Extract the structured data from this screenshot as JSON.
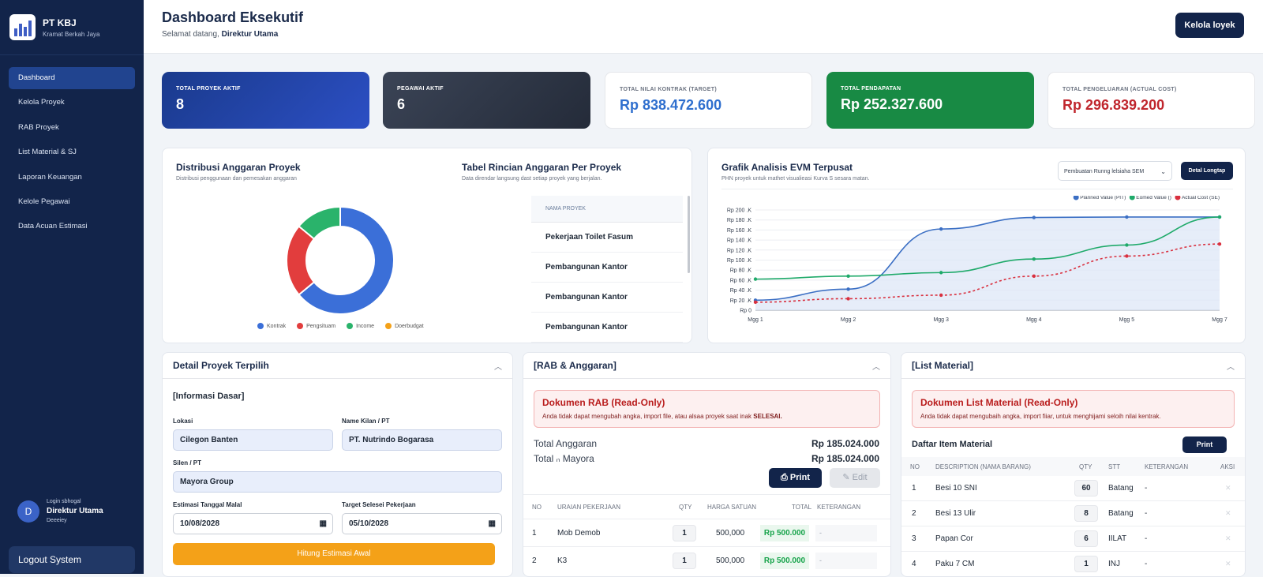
{
  "brand": {
    "name": "PT KBJ",
    "tagline": "Kramat Berkah Jaya"
  },
  "nav": [
    "Dashboard",
    "Kelola Proyek",
    "RAB Proyek",
    "List Material & SJ",
    "Laporan Keuangan",
    "Kelole Pegawai",
    "Data Acuan Estimasi"
  ],
  "user": {
    "initial": "D",
    "login_label": "Login sbhogal",
    "name": "Direktur Utama",
    "role": "Deeeiey"
  },
  "logout": "Logout System",
  "header": {
    "title": "Dashboard Eksekutif",
    "welcome": "Selamat datang,",
    "welcome_name": "Direktur Utama",
    "button": "Kelola loyek"
  },
  "kpis": [
    {
      "label": "TOTAL PROYEK AKTIF",
      "value": "8"
    },
    {
      "label": "PEGAWAI AKTIF",
      "value": "6"
    },
    {
      "label": "TOTAL NILAI KONTRAK (TARGET)",
      "value": "Rp 838.472.600"
    },
    {
      "label": "TOTAL PENDAPATAN",
      "value": "Rp 252.327.600"
    },
    {
      "label": "TOTAL PENGELUARAN (ACTUAL COST)",
      "value": "Rp 296.839.200"
    }
  ],
  "colors": {
    "navy": "#12244a",
    "blue": "#3b6fd8",
    "red": "#e23d3d",
    "green": "#2ab36b",
    "orange": "#f4a118"
  },
  "distribusi": {
    "title": "Distribusi Anggaran Proyek",
    "subtitle": "Distribusi penggunaan dan pemesakan anggaran",
    "chart_data": {
      "type": "pie",
      "labels": [
        "Kontrak",
        "Pengsituam",
        "Income",
        "Doerbudgat"
      ],
      "values": [
        64,
        22,
        14,
        0
      ],
      "colors": [
        "#3b6fd8",
        "#e23d3d",
        "#2ab36b",
        "#f4a118"
      ],
      "legend": "bottom"
    }
  },
  "tabel": {
    "title": "Tabel Rincian Anggaran Per Proyek",
    "subtitle": "Data direndar langsung dast setiap proyek yang berjalan.",
    "header": "NAMA PROYEK",
    "rows": [
      "Pekerjaan Toilet Fasum",
      "Pembangunan Kantor",
      "Pembangunan Kantor",
      "Pembangunan Kantor"
    ]
  },
  "evm": {
    "title": "Grafik Analisis EVM Terpusat",
    "subtitle": "PHN proyek untuk mathet visualieasi Kurva S sesara matan.",
    "select": "Pembuatan Runng lelsiaha SEM",
    "button": "Detal Longtap",
    "chart_data": {
      "type": "line",
      "x": [
        "Mgg 1",
        "Mgg 2",
        "Mgg 3",
        "Mgg 4",
        "Mgg 5",
        "Mgg 7"
      ],
      "yticks": [
        "Rp 0",
        "Rp 20 .K",
        "Rp 40 .K",
        "Rp 60 .K",
        "Rp 80 .K",
        "Rp 100 .K",
        "Rp 120 .K",
        "Rp 140 .K",
        "Rp 160 .K",
        "Rp 180 .K",
        "Rp 200 .K"
      ],
      "ylim": [
        0,
        200
      ],
      "series": [
        {
          "name": "Planned Value (PIT)",
          "color": "#3b6fc4",
          "values": [
            20,
            42,
            162,
            185,
            186,
            186
          ]
        },
        {
          "name": "Eomed Value ()",
          "color": "#1faa6a",
          "values": [
            62,
            68,
            75,
            102,
            130,
            186
          ]
        },
        {
          "name": "Actual Cost (SE)",
          "color": "#d9303f",
          "values": [
            16,
            23,
            30,
            68,
            108,
            132
          ]
        }
      ],
      "legend": "top-right"
    }
  },
  "detail": {
    "title": "Detail Proyek Terpilih",
    "section": "[Informasi Dasar]",
    "lokasi_label": "Lokasi",
    "lokasi": "Cilegon Banten",
    "klien_label": "Name Kilan / PT",
    "klien": "PT. Nutrindo Bogarasa",
    "silen_label": "Silen / PT",
    "silen": "Mayora Group",
    "mulai_label": "Estimasi Tanggal Malal",
    "mulai": "10/08/2028",
    "target_label": "Target Selesei Pekerjaan",
    "target": "05/10/2028",
    "button": "Hitung Estimasi Awal"
  },
  "rab": {
    "title": "[RAB & Anggaran]",
    "alert_title": "Dokumen RAB (Read-Only)",
    "alert_body": "Anda tidak dapat mengubah angka, import file, atau alsaa proyek saat inak",
    "alert_bold": "SELESAI.",
    "total_label": "Total Anggaran",
    "total_value": "Rp 185.024.000",
    "mayora_label": "Total ₙ Mayora",
    "mayora_value": "Rp 185.024.000",
    "print": "Print",
    "edit": "Edit",
    "headers": [
      "NO",
      "URAIAN PEKERJAAN",
      "QTY",
      "HARGA SATUAN",
      "TOTAL",
      "KETERANGAN"
    ],
    "rows": [
      {
        "no": "1",
        "uraian": "Mob Demob",
        "qty": "1",
        "harga": "500,000",
        "total": "Rp 500.000",
        "ket": "-"
      },
      {
        "no": "2",
        "uraian": "K3",
        "qty": "1",
        "harga": "500,000",
        "total": "Rp 500.000",
        "ket": "-"
      }
    ]
  },
  "material": {
    "title": "[List Material]",
    "alert_title": "Dokumen List Material (Read-Only)",
    "alert_body": "Anda tidak dapat mengubaih angka, import fiiar, untuk menghijami seloih nilai kentrak.",
    "list_title": "Daftar Item Material",
    "print": "Print",
    "headers": [
      "NO",
      "DESCRIPTION (NAMA BARANG)",
      "QTY",
      "STT",
      "KETERANGAN",
      "AKSI"
    ],
    "rows": [
      {
        "no": "1",
        "desc": "Besi 10 SNI",
        "qty": "60",
        "stt": "Batang",
        "ket": "-"
      },
      {
        "no": "2",
        "desc": "Besi 13 Ulir",
        "qty": "8",
        "stt": "Batang",
        "ket": "-"
      },
      {
        "no": "3",
        "desc": "Papan Cor",
        "qty": "6",
        "stt": "IILAT",
        "ket": "-"
      },
      {
        "no": "4",
        "desc": "Paku 7 CM",
        "qty": "1",
        "stt": "INJ",
        "ket": "-"
      }
    ]
  }
}
